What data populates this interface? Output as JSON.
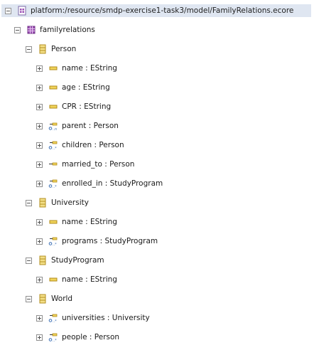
{
  "resource": {
    "uri": "platform:/resource/smdp-exercise1-task3/model/FamilyRelations.ecore",
    "package": {
      "name": "familyrelations",
      "classes": [
        {
          "name": "Person",
          "features": [
            {
              "label": "name : EString",
              "kind": "attribute",
              "icon": "eattribute-icon"
            },
            {
              "label": "age : EString",
              "kind": "attribute",
              "icon": "eattribute-icon"
            },
            {
              "label": "CPR : EString",
              "kind": "attribute",
              "icon": "eattribute-icon"
            },
            {
              "label": "parent : Person",
              "kind": "reference",
              "icon": "ereference-0n-icon"
            },
            {
              "label": "children : Person",
              "kind": "reference",
              "icon": "ereference-0many-icon"
            },
            {
              "label": "married_to : Person",
              "kind": "reference",
              "icon": "ereference-single-icon"
            },
            {
              "label": "enrolled_in : StudyProgram",
              "kind": "reference",
              "icon": "ereference-0many-icon"
            }
          ]
        },
        {
          "name": "University",
          "features": [
            {
              "label": "name : EString",
              "kind": "attribute",
              "icon": "eattribute-icon"
            },
            {
              "label": "programs : StudyProgram",
              "kind": "reference",
              "icon": "ereference-0many-icon"
            }
          ]
        },
        {
          "name": "StudyProgram",
          "features": [
            {
              "label": "name : EString",
              "kind": "attribute",
              "icon": "eattribute-icon"
            }
          ]
        },
        {
          "name": "World",
          "features": [
            {
              "label": "universities : University",
              "kind": "reference",
              "icon": "ereference-0many-icon"
            },
            {
              "label": "people : Person",
              "kind": "reference",
              "icon": "ereference-0many-icon"
            }
          ]
        }
      ]
    }
  },
  "colors": {
    "selection": "#dfe6f1",
    "attribute": "#e8cf5a",
    "class": "#d9b94a",
    "package": "#9b4fb4",
    "reference": "#5a7fb8"
  }
}
